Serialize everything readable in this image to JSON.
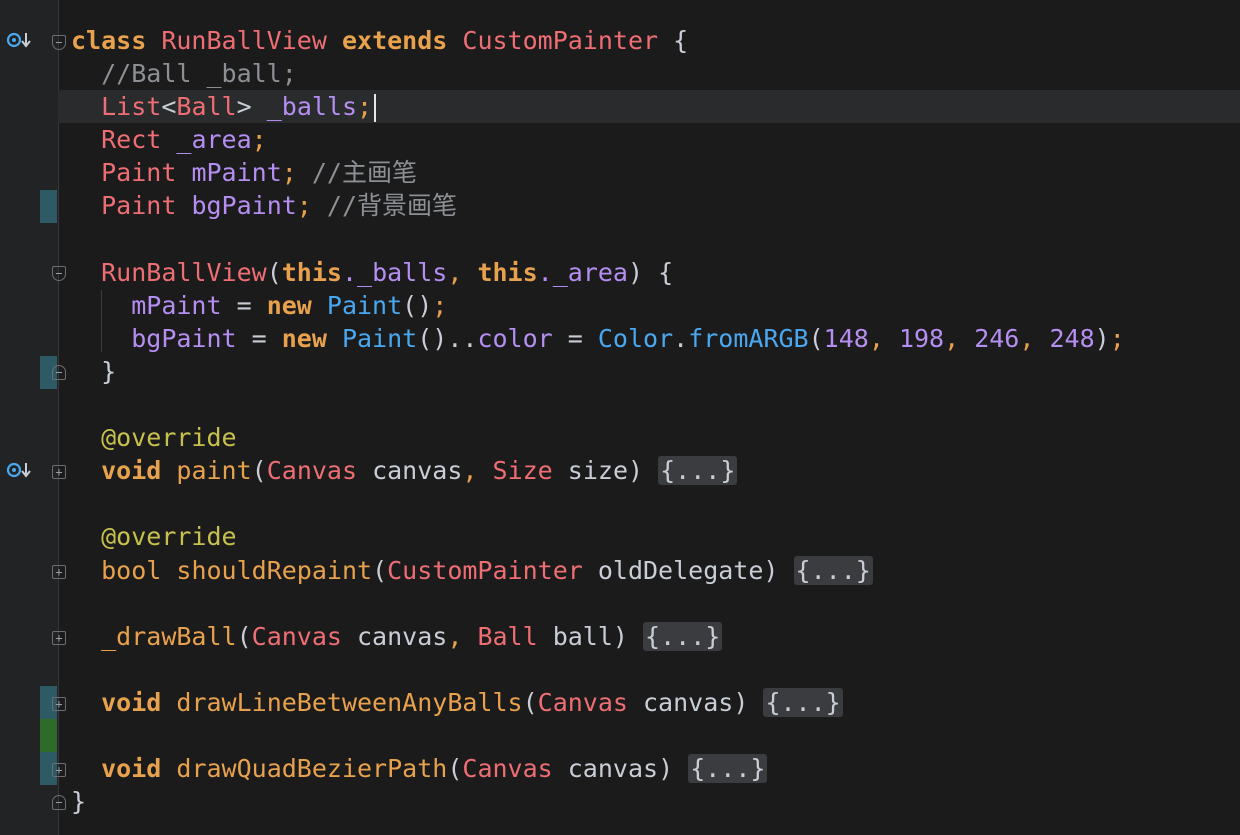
{
  "colors": {
    "background": "#1b1b1c",
    "gutter": "#222325",
    "keyword": "#e8a14c",
    "type": "#ee6e73",
    "field": "#b48ef0",
    "comment": "#8c8f94",
    "call": "#4aa8f0",
    "annotation": "#c7c04d",
    "change_modified": "#2e5a66",
    "change_added": "#2e6b2a"
  },
  "icons": {
    "override": "override-down-arrow-icon",
    "fold_expand": "plus-box-icon",
    "fold_collapse": "minus-box-icon"
  },
  "code": {
    "l1": {
      "kw1": "class",
      "name": "RunBallView",
      "kw2": "extends",
      "base": "CustomPainter",
      "brace": " {"
    },
    "l2": {
      "comment": "//Ball _ball;"
    },
    "l3": {
      "type": "List",
      "lt": "<",
      "arg": "Ball",
      "gt": ">",
      "field": "_balls",
      "semi": ";"
    },
    "l4": {
      "type": "Rect",
      "field": "_area",
      "semi": ";"
    },
    "l5": {
      "type": "Paint",
      "field": "mPaint",
      "semi": ";",
      "comment": "//主画笔"
    },
    "l6": {
      "type": "Paint",
      "field": "bgPaint",
      "semi": ";",
      "comment": "//背景画笔"
    },
    "l8": {
      "ctor": "RunBallView",
      "p1": "(",
      "this1": "this",
      "f1": "._balls",
      "comma": ",",
      "this2": "this",
      "f2": "._area",
      "p2": ")",
      "brace": " {"
    },
    "l9": {
      "field": "mPaint",
      "eq": " = ",
      "kw": "new",
      "call": "Paint",
      "parens": "()",
      "semi": ";"
    },
    "l10": {
      "field": "bgPaint",
      "eq": " = ",
      "kw": "new",
      "call": "Paint",
      "cascade": "()..",
      "prop": "color",
      "eq2": " = ",
      "cls": "Color",
      "dot": ".",
      "method": "fromARGB",
      "p1": "(",
      "n1": "148",
      "n2": "198",
      "n3": "246",
      "n4": "248",
      "p2": ")",
      "semi": ";",
      "sep": ", "
    },
    "l11": {
      "brace": "}"
    },
    "l13": {
      "ann": "@override"
    },
    "l14": {
      "kw": "void",
      "fn": "paint",
      "p1": "(",
      "t1": "Canvas",
      "a1": " canvas",
      "comma": ",",
      "t2": "Size",
      "a2": " size",
      "p2": ")",
      "fold": "{...}"
    },
    "l16": {
      "ann": "@override"
    },
    "l17": {
      "kw": "bool",
      "fn": "shouldRepaint",
      "p1": "(",
      "t1": "CustomPainter",
      "a1": " oldDelegate",
      "p2": ")",
      "fold": "{...}"
    },
    "l19": {
      "fn": "_drawBall",
      "p1": "(",
      "t1": "Canvas",
      "a1": " canvas",
      "comma": ",",
      "t2": "Ball",
      "a2": " ball",
      "p2": ")",
      "fold": "{...}"
    },
    "l21": {
      "kw": "void",
      "fn": "drawLineBetweenAnyBalls",
      "p1": "(",
      "t1": "Canvas",
      "a1": " canvas",
      "p2": ")",
      "fold": "{...}"
    },
    "l23": {
      "kw": "void",
      "fn": "drawQuadBezierPath",
      "p1": "(",
      "t1": "Canvas",
      "a1": " canvas",
      "p2": ")",
      "fold": "{...}"
    },
    "l24": {
      "brace": "}"
    }
  }
}
